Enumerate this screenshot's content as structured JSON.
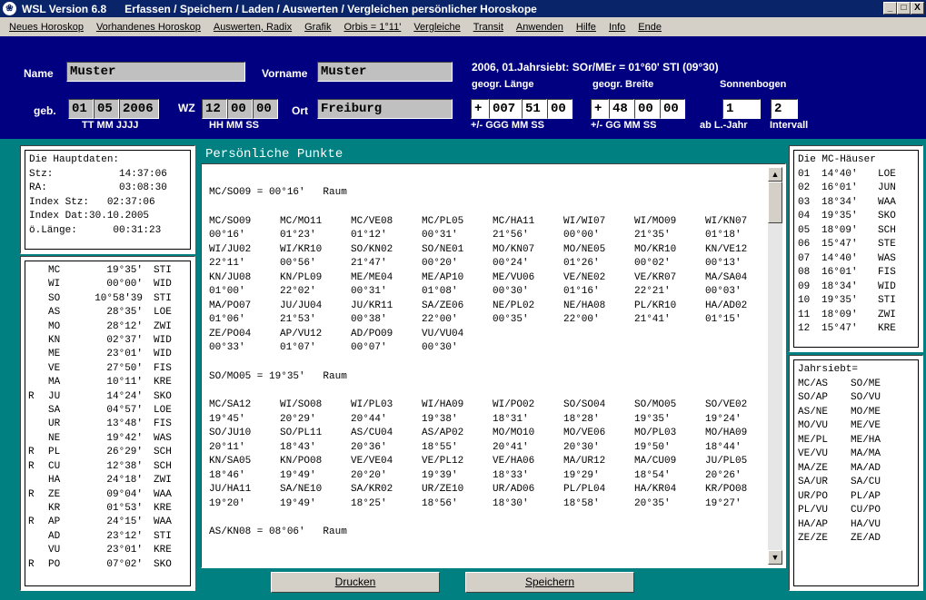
{
  "window": {
    "app": "WSL Version 6.8",
    "title": "Erfassen / Speichern / Laden / Auswerten / Vergleichen persönlicher Horoskope",
    "btn_min": "_",
    "btn_max": "□",
    "btn_close": "X"
  },
  "menu": [
    "Neues Horoskop",
    "Vorhandenes Horoskop",
    "Auswerten, Radix",
    "Grafik",
    "Orbis = 1°11'",
    "Vergleiche",
    "Transit",
    "Anwenden",
    "Hilfe",
    "Info",
    "Ende"
  ],
  "form": {
    "name_label": "Name",
    "name": "Muster",
    "vorname_label": "Vorname",
    "vorname": "Muster",
    "info_line": "2006, 01.Jahrsiebt: SOr/MEr = 01°60' STI (09°30)",
    "laenge_label": "geogr. Länge",
    "breite_label": "geogr. Breite",
    "sonnenbogen_label": "Sonnenbogen",
    "geb_label": "geb.",
    "tt": "01",
    "mm": "05",
    "jjjj": "2006",
    "date_hint": "TT MM  JJJJ",
    "wz_label": "WZ",
    "wz_hh": "12",
    "wz_mm": "00",
    "wz_ss": "00",
    "time_hint": "HH  MM  SS",
    "ort_label": "Ort",
    "ort": "Freiburg",
    "lon_sign": "+",
    "lon_ggg": "007",
    "lon_mm": "51",
    "lon_ss": "00",
    "lon_hint": "+/-  GGG  MM  SS",
    "lat_sign": "+",
    "lat_gg": "48",
    "lat_mm": "00",
    "lat_ss": "00",
    "lat_hint": "+/-  GG  MM  SS",
    "ab_jahr": "1",
    "ab_jahr_hint": "ab L.-Jahr",
    "intervall": "2",
    "intervall_hint": "Intervall"
  },
  "hauptdaten": {
    "lines": [
      "Die Hauptdaten:",
      "Stz:           14:37:06",
      "RA:            03:08:30",
      "Index Stz:   02:37:06",
      "Index Dat:30.10.2005",
      "ö.Länge:      00:31:23"
    ]
  },
  "planets": [
    {
      "r": "",
      "p": "MC",
      "deg": "19°35'",
      "s": "STI"
    },
    {
      "r": "",
      "p": "WI",
      "deg": "00°00'",
      "s": "WID"
    },
    {
      "r": "",
      "p": "SO",
      "deg": "10°58'39",
      "s": "STI"
    },
    {
      "r": "",
      "p": "AS",
      "deg": "28°35'",
      "s": "LOE"
    },
    {
      "r": "",
      "p": "MO",
      "deg": "28°12'",
      "s": "ZWI"
    },
    {
      "r": "",
      "p": "KN",
      "deg": "02°37'",
      "s": "WID"
    },
    {
      "r": "",
      "p": "ME",
      "deg": "23°01'",
      "s": "WID"
    },
    {
      "r": "",
      "p": "VE",
      "deg": "27°50'",
      "s": "FIS"
    },
    {
      "r": "",
      "p": "MA",
      "deg": "10°11'",
      "s": "KRE"
    },
    {
      "r": "R",
      "p": "JU",
      "deg": "14°24'",
      "s": "SKO"
    },
    {
      "r": "",
      "p": "SA",
      "deg": "04°57'",
      "s": "LOE"
    },
    {
      "r": "",
      "p": "UR",
      "deg": "13°48'",
      "s": "FIS"
    },
    {
      "r": "",
      "p": "NE",
      "deg": "19°42'",
      "s": "WAS"
    },
    {
      "r": "R",
      "p": "PL",
      "deg": "26°29'",
      "s": "SCH"
    },
    {
      "r": "R",
      "p": "CU",
      "deg": "12°38'",
      "s": "SCH"
    },
    {
      "r": "",
      "p": "HA",
      "deg": "24°18'",
      "s": "ZWI"
    },
    {
      "r": "R",
      "p": "ZE",
      "deg": "09°04'",
      "s": "WAA"
    },
    {
      "r": "",
      "p": "KR",
      "deg": "01°53'",
      "s": "KRE"
    },
    {
      "r": "R",
      "p": "AP",
      "deg": "24°15'",
      "s": "WAA"
    },
    {
      "r": "",
      "p": "AD",
      "deg": "23°12'",
      "s": "STI"
    },
    {
      "r": "",
      "p": "VU",
      "deg": "23°01'",
      "s": "KRE"
    },
    {
      "r": "R",
      "p": "PO",
      "deg": "07°02'",
      "s": "SKO"
    }
  ],
  "section_title": "Persönliche Punkte",
  "points": {
    "h1": "MC/SO09 = 00°16'   Raum",
    "g1": [
      [
        "MC/SO09",
        "MC/MO11",
        "MC/VE08",
        "MC/PL05",
        "MC/HA11",
        "WI/WI07",
        "WI/MO09",
        "WI/KN07"
      ],
      [
        "00°16'",
        "01°23'",
        "01°12'",
        "00°31'",
        "21°56'",
        "00°00'",
        "21°35'",
        "01°18'"
      ],
      [
        "WI/JU02",
        "WI/KR10",
        "SO/KN02",
        "SO/NE01",
        "MO/KN07",
        "MO/NE05",
        "MO/KR10",
        "KN/VE12"
      ],
      [
        "22°11'",
        "00°56'",
        "21°47'",
        "00°20'",
        "00°24'",
        "01°26'",
        "00°02'",
        "00°13'"
      ],
      [
        "KN/JU08",
        "KN/PL09",
        "ME/ME04",
        "ME/AP10",
        "ME/VU06",
        "VE/NE02",
        "VE/KR07",
        "MA/SA04"
      ],
      [
        "01°00'",
        "22°02'",
        "00°31'",
        "01°08'",
        "00°30'",
        "01°16'",
        "22°21'",
        "00°03'"
      ],
      [
        "MA/PO07",
        "JU/JU04",
        "JU/KR11",
        "SA/ZE06",
        "NE/PL02",
        "NE/HA08",
        "PL/KR10",
        "HA/AD02"
      ],
      [
        "01°06'",
        "21°53'",
        "00°38'",
        "22°00'",
        "00°35'",
        "22°00'",
        "21°41'",
        "01°15'"
      ],
      [
        "ZE/PO04",
        "AP/VU12",
        "AD/PO09",
        "VU/VU04",
        "",
        "",
        "",
        ""
      ],
      [
        "00°33'",
        "01°07'",
        "00°07'",
        "00°30'",
        "",
        "",
        "",
        ""
      ]
    ],
    "h2": "SO/MO05 = 19°35'   Raum",
    "g2": [
      [
        "MC/SA12",
        "WI/SO08",
        "WI/PL03",
        "WI/HA09",
        "WI/PO02",
        "SO/SO04",
        "SO/MO05",
        "SO/VE02"
      ],
      [
        "19°45'",
        "20°29'",
        "20°44'",
        "19°38'",
        "18°31'",
        "18°28'",
        "19°35'",
        "19°24'"
      ],
      [
        "SO/JU10",
        "SO/PL11",
        "AS/CU04",
        "AS/AP02",
        "MO/MO10",
        "MO/VE06",
        "MO/PL03",
        "MO/HA09"
      ],
      [
        "20°11'",
        "18°43'",
        "20°36'",
        "18°55'",
        "20°41'",
        "20°30'",
        "19°50'",
        "18°44'"
      ],
      [
        "KN/SA05",
        "KN/PO08",
        "VE/VE04",
        "VE/PL12",
        "VE/HA06",
        "MA/UR12",
        "MA/CU09",
        "JU/PL05"
      ],
      [
        "18°46'",
        "19°49'",
        "20°20'",
        "19°39'",
        "18°33'",
        "19°29'",
        "18°54'",
        "20°26'"
      ],
      [
        "JU/HA11",
        "SA/NE10",
        "SA/KR02",
        "UR/ZE10",
        "UR/AD06",
        "PL/PL04",
        "HA/KR04",
        "KR/PO08"
      ],
      [
        "19°20'",
        "19°49'",
        "18°25'",
        "18°56'",
        "18°30'",
        "18°58'",
        "20°35'",
        "19°27'"
      ]
    ],
    "h3": "AS/KN08 = 08°06'   Raum"
  },
  "houses": {
    "title": "Die MC-Häuser",
    "rows": [
      [
        "01",
        "14°40'",
        "LOE"
      ],
      [
        "02",
        "16°01'",
        "JUN"
      ],
      [
        "03",
        "18°34'",
        "WAA"
      ],
      [
        "04",
        "19°35'",
        "SKO"
      ],
      [
        "05",
        "18°09'",
        "SCH"
      ],
      [
        "06",
        "15°47'",
        "STE"
      ],
      [
        "07",
        "14°40'",
        "WAS"
      ],
      [
        "08",
        "16°01'",
        "FIS"
      ],
      [
        "09",
        "18°34'",
        "WID"
      ],
      [
        "10",
        "19°35'",
        "STI"
      ],
      [
        "11",
        "18°09'",
        "ZWI"
      ],
      [
        "12",
        "15°47'",
        "KRE"
      ]
    ]
  },
  "jahrsiebt": {
    "title": "Jahrsiebt=",
    "rows": [
      [
        "MC/AS",
        "SO/ME"
      ],
      [
        "SO/AP",
        "SO/VU"
      ],
      [
        "AS/NE",
        "MO/ME"
      ],
      [
        "MO/VU",
        "ME/VE"
      ],
      [
        "ME/PL",
        "ME/HA"
      ],
      [
        "VE/VU",
        "MA/MA"
      ],
      [
        "MA/ZE",
        "MA/AD"
      ],
      [
        "SA/UR",
        "SA/CU"
      ],
      [
        "UR/PO",
        "PL/AP"
      ],
      [
        "PL/VU",
        "CU/PO"
      ],
      [
        "HA/AP",
        "HA/VU"
      ],
      [
        "ZE/ZE",
        "ZE/AD"
      ]
    ]
  },
  "buttons": {
    "drucken": "Drucken",
    "speichern": "Speichern"
  }
}
